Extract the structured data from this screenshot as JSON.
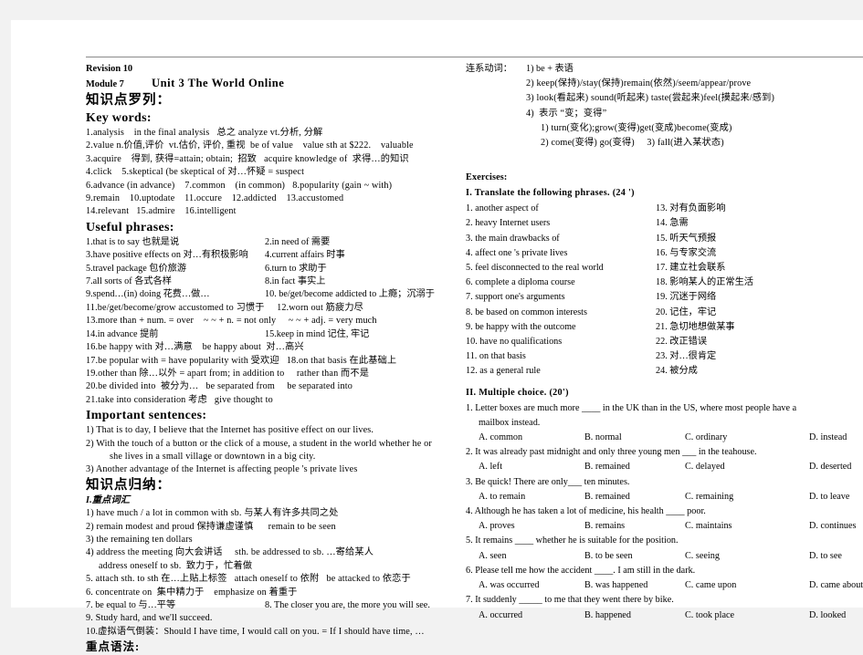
{
  "document": {
    "revision_label": "Revision 10",
    "module_label": "Module 7",
    "unit_title": "Unit 3    The World Online",
    "knowledge_list_heading": "知识点罗列：",
    "key_words_heading": "Key words:",
    "key_words": [
      "1.analysis    in the final analysis   总之 analyze vt.分析, 分解",
      "2.value n.价值,评价  vt.估价, 评价, 重视  be of value    value sth at $222.    valuable",
      "3.acquire    得到, 获得=attain; obtain;  招致   acquire knowledge of  求得…的知识",
      "4.click    5.skeptical (be skeptical of 对…怀疑 = suspect",
      "6.advance (in advance)    7.common    (in common)   8.popularity (gain ~ with)",
      "9.remain    10.uptodate    11.occure    12.addicted    13.accustomed",
      "14.relevant   15.admire    16.intelligent"
    ],
    "useful_phrases_heading": "Useful phrases:",
    "useful_phrases_pairs": [
      [
        "1.that is to say 也就是说",
        "2.in need of 需要"
      ],
      [
        "3.have positive effects on 对…有积极影响",
        "4.current affairs 时事"
      ],
      [
        "5.travel package 包价旅游",
        "6.turn to 求助于"
      ],
      [
        "7.all sorts of 各式各样",
        "8.in fact 事实上"
      ],
      [
        "9.spend…(in) doing 花费…做…",
        "10. be/get/become addicted to 上瘾；沉溺于"
      ]
    ],
    "useful_phrases_lines": [
      "11.be/get/become/grow accustomed to 习惯于     12.worn out 筋疲力尽",
      "13.more than + num. = over    ~ ~ + n. = not only     ~ ~ + adj. = very much"
    ],
    "useful_phrases_pairs2": [
      [
        "14.in advance 提前",
        "15.keep in mind 记住, 牢记"
      ]
    ],
    "useful_phrases_lines2": [
      "16.be happy with 对…满意    be happy about  对…高兴",
      "17.be popular with = have popularity with 受欢迎   18.on that basis 在此基础上",
      "19.other than 除…以外 = apart from; in addition to     rather than 而不是",
      "20.be divided into  被分为…   be separated from     be separated into",
      "21.take into consideration 考虑   give thought to"
    ],
    "important_sentences_heading": "Important sentences:",
    "important_sentences": [
      "1) That is to day, I believe that the Internet has positive effect on our lives.",
      "2) With the touch of a button or the click of a mouse, a student in the world whether he or",
      "she lives in a small village or downtown in a big city.",
      "3) Another advantage of the Internet is affecting people 's private lives"
    ],
    "summary_heading": "知识点归纳：",
    "vocab_subheading": "I.重点词汇",
    "vocab_items": [
      "1) have much / a lot in common with sb. 与某人有许多共同之处",
      "2) remain modest and proud 保持谦虚谨慎      remain to be seen",
      "3) the remaining ten dollars",
      "4) address the meeting 向大会讲话     sth. be addressed to sb. …寄给某人",
      "address oneself to sb.  致力于，忙着做",
      "5. attach sth. to sth 在…上贴上标签   attach oneself to 依附   be attacked to 依恋于",
      "6. concentrate on  集中精力于    emphasize on 着重于"
    ],
    "vocab_pair": [
      "7. be equal to 与…平等",
      "8. The closer you are, the more you will see."
    ],
    "vocab_items2": [
      "9. Study hard, and we'll succeed.",
      "10.虚拟语气倒装：Should I have time, I would call on you. = If I should have time, …"
    ],
    "grammar_heading": "重点语法:"
  },
  "right": {
    "linking_verbs": {
      "label": "连系动词：",
      "items": [
        "1) be +  表语",
        "2) keep(保持)/stay(保持)remain(依然)/seem/appear/prove",
        "3) look(看起来) sound(听起来) taste(尝起来)feel(摸起来/感到)",
        "4)  表示 “变；变得”"
      ],
      "subitems": [
        "1) turn(变化);grow(变得)get(变成)become(变成)",
        "2) come(变得) go(变得)     3) fall(进入某状态)"
      ]
    },
    "exercises_heading": "Exercises:",
    "section1_heading": "I. Translate the following phrases. (24 ')",
    "translate_items_left": [
      "1. another aspect of",
      "2. heavy Internet users",
      "3. the main drawbacks of",
      "4. affect one 's private lives",
      "5. feel disconnected to the real world",
      "6. complete a diploma course",
      "7. support one's arguments",
      "8. be based on common interests",
      "9. be happy with the outcome",
      "10. have no qualifications",
      "11. on that basis",
      "12. as a general rule"
    ],
    "translate_items_right": [
      "13. 对有负面影响",
      "14.  急需",
      "15.  听天气预报",
      "16.  与专家交流",
      "17.  建立社会联系",
      "18.  影响某人的正常生活",
      "19.  沉迷于网络",
      " 20.  记住，牢记",
      "21.  急切地想做某事",
      "22.  改正错误",
      "23.  对…很肯定",
      "24.  被分成"
    ],
    "section2_heading": "II. Multiple choice. (20')",
    "questions": [
      {
        "stem": "1. Letter boxes are much more ____ in the UK than in the US, where most people have a",
        "stem2": "mailbox instead.",
        "options": [
          "A. common",
          "B. normal",
          "C. ordinary",
          "D. instead"
        ]
      },
      {
        "stem": "2. It was already past midnight and only three young men ___ in the teahouse.",
        "stem2": "",
        "options": [
          "A. left",
          "B. remained",
          "C. delayed",
          "D. deserted"
        ]
      },
      {
        "stem": "3. Be quick! There are only___ ten minutes.",
        "stem2": "",
        "options": [
          "A. to remain",
          "B. remained",
          "C. remaining",
          "D. to leave"
        ]
      },
      {
        "stem": "4. Although he has taken a lot of medicine, his health ____ poor.",
        "stem2": "",
        "options": [
          "A. proves",
          "B. remains",
          "C. maintains",
          "D. continues"
        ]
      },
      {
        "stem": "5. It remains ____ whether he is suitable for the position.",
        "stem2": "",
        "options": [
          "A. seen",
          "B. to be seen",
          "C. seeing",
          "D. to see"
        ]
      },
      {
        "stem": "6. Please tell me how the accident ____. I am still in the dark.",
        "stem2": "",
        "options": [
          "A. was occurred",
          "B. was happened",
          "C. came upon",
          "D. came about"
        ]
      },
      {
        "stem": "7. It suddenly _____ to me that they went there by bike.",
        "stem2": "",
        "options": [
          "A. occurred",
          "B. happened",
          "C. took place",
          "D. looked"
        ]
      }
    ]
  }
}
